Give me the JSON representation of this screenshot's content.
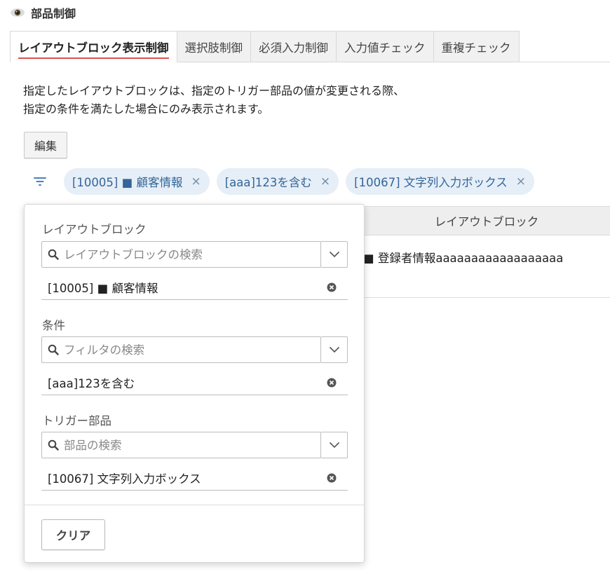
{
  "header": {
    "title": "部品制御",
    "icon": "eye-icon"
  },
  "tabs": [
    {
      "label": "レイアウトブロック表示制御",
      "active": true
    },
    {
      "label": "選択肢制御",
      "active": false
    },
    {
      "label": "必須入力制御",
      "active": false
    },
    {
      "label": "入力値チェック",
      "active": false
    },
    {
      "label": "重複チェック",
      "active": false
    }
  ],
  "description": {
    "line1": "指定したレイアウトブロックは、指定のトリガー部品の値が変更される際、",
    "line2": "指定の条件を満たした場合にのみ表示されます。"
  },
  "edit_button": "編集",
  "filter_chips": [
    {
      "label": "[10005] ■ 顧客情報",
      "close": "×"
    },
    {
      "label": "[aaa]123を含む",
      "close": "×"
    },
    {
      "label": "[10067] 文字列入力ボックス",
      "close": "×"
    }
  ],
  "table": {
    "header": "レイアウトブロック",
    "cell": "■ 登録者情報aaaaaaaaaaaaaaaaaa"
  },
  "filter_panel": {
    "sections": [
      {
        "label": "レイアウトブロック",
        "placeholder": "レイアウトブロックの検索",
        "selected": "[10005] ■ 顧客情報"
      },
      {
        "label": "条件",
        "placeholder": "フィルタの検索",
        "selected": "[aaa]123を含む"
      },
      {
        "label": "トリガー部品",
        "placeholder": "部品の検索",
        "selected": "[10067] 文字列入力ボックス"
      }
    ],
    "clear_button": "クリア"
  },
  "colors": {
    "accent_underline": "#d9534f",
    "chip_bg": "#e6eef7",
    "chip_text": "#336699",
    "filter_icon": "#4a7fc1"
  }
}
